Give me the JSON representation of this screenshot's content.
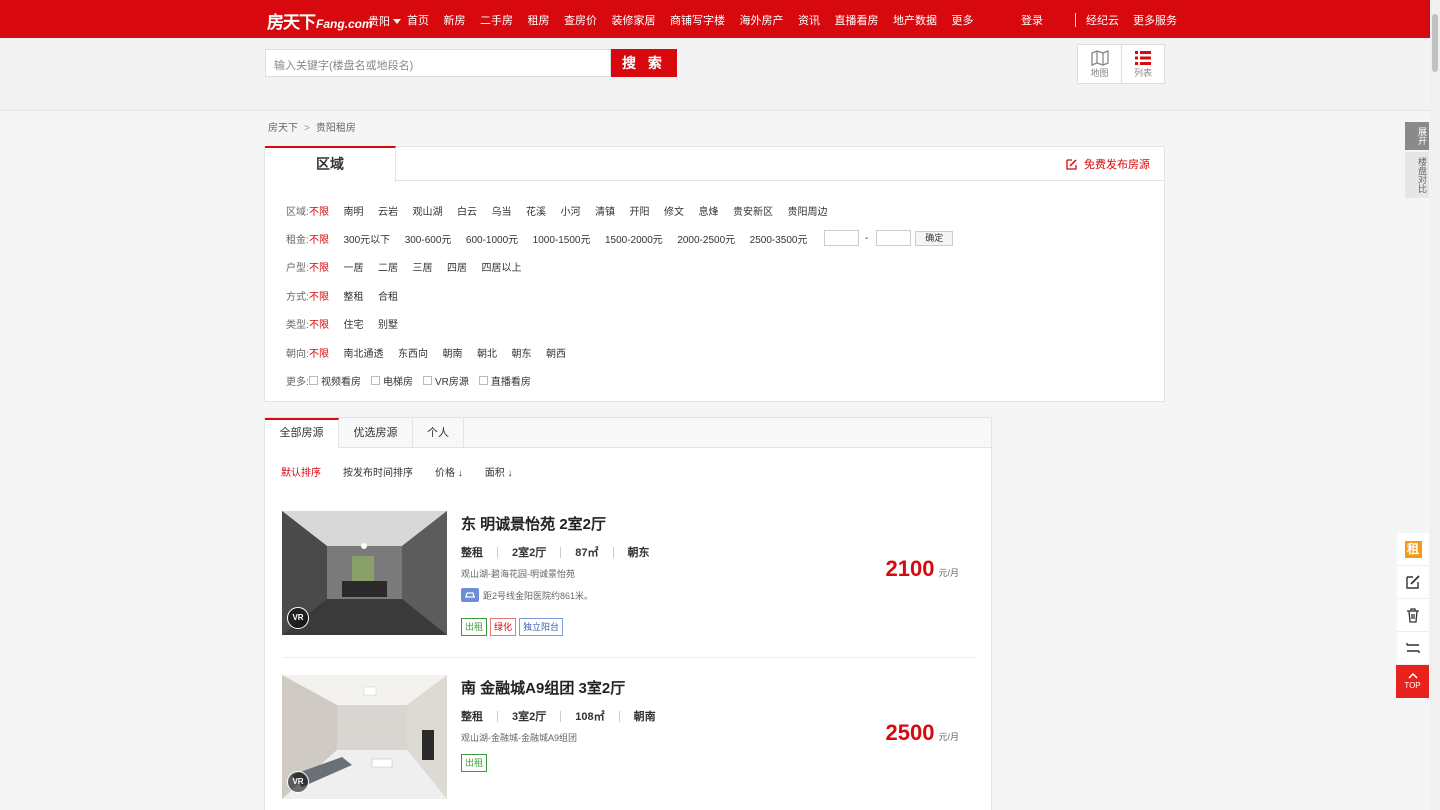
{
  "topnav": {
    "logo_cn": "房天下",
    "logo_en": "Fang.com",
    "city": "贵阳",
    "links": [
      "首页",
      "新房",
      "二手房",
      "租房",
      "查房价",
      "装修家居",
      "商铺写字楼",
      "海外房产",
      "资讯",
      "直播看房",
      "地产数据",
      "更多"
    ],
    "login": "登录",
    "agent": "经纪云",
    "more_services": "更多服务"
  },
  "search": {
    "placeholder": "输入关键字(楼盘名或地段名)",
    "button": "搜 索",
    "view_map": "地图",
    "view_list": "列表"
  },
  "breadcrumb": [
    "房天下",
    "贵阳租房"
  ],
  "filter": {
    "tab": "区域",
    "publish": "免费发布房源",
    "rows": [
      {
        "label": "区域:",
        "options": [
          "不限",
          "南明",
          "云岩",
          "观山湖",
          "白云",
          "乌当",
          "花溪",
          "小河",
          "清镇",
          "开阳",
          "修文",
          "息烽",
          "贵安新区",
          "贵阳周边"
        ]
      },
      {
        "label": "租金:",
        "options": [
          "不限",
          "300元以下",
          "300-600元",
          "600-1000元",
          "1000-1500元",
          "1500-2000元",
          "2000-2500元",
          "2500-3500元"
        ],
        "confirm": "确定",
        "dash": "-"
      },
      {
        "label": "户型:",
        "options": [
          "不限",
          "一居",
          "二居",
          "三居",
          "四居",
          "四居以上"
        ]
      },
      {
        "label": "方式:",
        "options": [
          "不限",
          "整租",
          "合租"
        ]
      },
      {
        "label": "类型:",
        "options": [
          "不限",
          "住宅",
          "别墅"
        ]
      },
      {
        "label": "朝向:",
        "options": [
          "不限",
          "南北通透",
          "东西向",
          "朝南",
          "朝北",
          "朝东",
          "朝西"
        ]
      },
      {
        "label": "更多:",
        "checks": [
          "视频看房",
          "电梯房",
          "VR房源",
          "直播看房"
        ]
      }
    ]
  },
  "listing": {
    "tabs": [
      "全部房源",
      "优选房源",
      "个人"
    ],
    "sort": [
      "默认排序",
      "按发布时间排序",
      "价格 ↓",
      "面积 ↓"
    ],
    "houses": [
      {
        "title": "东 明诚景怡苑 2室2厅",
        "attrs": [
          "整租",
          "2室2厅",
          "87㎡",
          "朝东"
        ],
        "addr": "观山湖-碧海花园-明诚景怡苑",
        "subway": "距2号线金阳医院约861米。",
        "tags": [
          {
            "t": "出租",
            "c": "g"
          },
          {
            "t": "绿化",
            "c": "r"
          },
          {
            "t": "独立阳台",
            "c": "b"
          }
        ],
        "price": "2100",
        "unit": "元/月",
        "vr": "VR"
      },
      {
        "title": "南 金融城A9组团 3室2厅",
        "attrs": [
          "整租",
          "3室2厅",
          "108㎡",
          "朝南"
        ],
        "addr": "观山湖-金融城-金融城A9组团",
        "tags": [
          {
            "t": "出租",
            "c": "g"
          }
        ],
        "price": "2500",
        "unit": "元/月",
        "vr": "VR"
      }
    ]
  },
  "side": {
    "expand": "展开",
    "compare": "楼盘对比",
    "zu": "租",
    "top": "TOP"
  }
}
